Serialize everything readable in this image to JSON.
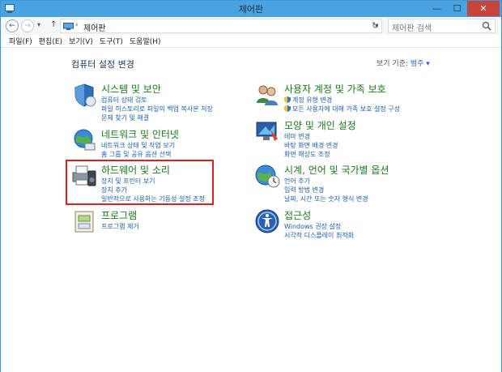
{
  "window": {
    "title": "제어판"
  },
  "address": {
    "path": "제어판",
    "search_placeholder": "제어판 검색"
  },
  "menu": [
    "파일(F)",
    "편집(E)",
    "보기(V)",
    "도구(T)",
    "도움말(H)"
  ],
  "main": {
    "heading": "컴퓨터 설정 변경",
    "view_by_label": "보기 기준:",
    "view_by_value": "범주 ▾"
  },
  "categories": [
    {
      "title": "시스템 및 보안",
      "links": [
        {
          "text": "컴퓨터 상태 검토"
        },
        {
          "text": "파일 히스토리로 파일의 백업 복사본 저장"
        },
        {
          "text": "문제 찾기 및 해결"
        }
      ]
    },
    {
      "title": "네트워크 및 인터넷",
      "links": [
        {
          "text": "네트워크 상태 및 작업 보기"
        },
        {
          "text": "홈 그룹 및 공유 옵션 선택"
        }
      ]
    },
    {
      "title": "하드웨어 및 소리",
      "links": [
        {
          "text": "장치 및 프린터 보기"
        },
        {
          "text": "장치 추가"
        },
        {
          "text": "일반적으로 사용하는 기동성 설정 조정"
        }
      ]
    },
    {
      "title": "프로그램",
      "links": [
        {
          "text": "프로그램 제거"
        }
      ]
    },
    {
      "title": "사용자 계정 및 가족 보호",
      "links": [
        {
          "text": "계정 유형 변경",
          "shield": true
        },
        {
          "text": "모든 사용자에 대해 가족 보호 설정 구성",
          "shield": true
        }
      ]
    },
    {
      "title": "모양 및 개인 설정",
      "links": [
        {
          "text": "테마 변경"
        },
        {
          "text": "바탕 화면 배경 변경"
        },
        {
          "text": "화면 해상도 조정"
        }
      ]
    },
    {
      "title": "시계, 언어 및 국가별 옵션",
      "links": [
        {
          "text": "언어 추가"
        },
        {
          "text": "입력 방법 변경"
        },
        {
          "text": "날짜, 시간 또는 숫자 형식 변경"
        }
      ]
    },
    {
      "title": "접근성",
      "links": [
        {
          "text": "Windows 권장 설정"
        },
        {
          "text": "시각적 디스플레이 최적화"
        }
      ]
    }
  ]
}
